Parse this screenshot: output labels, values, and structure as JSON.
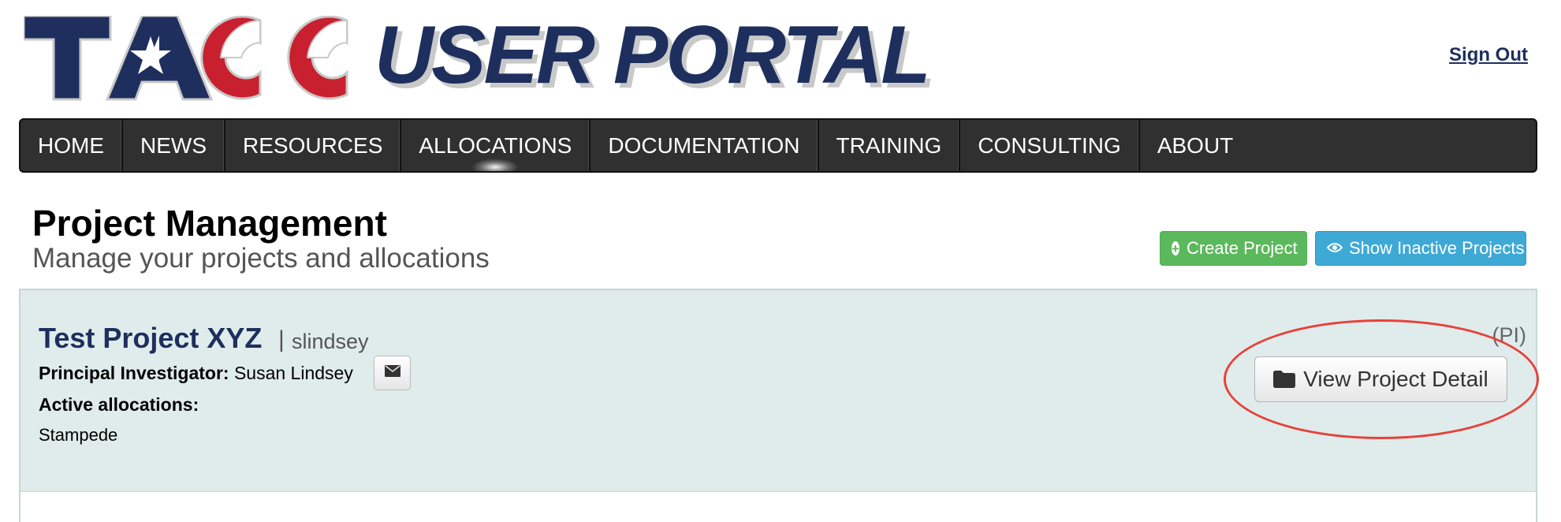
{
  "header": {
    "logo_text": "TACC",
    "portal_title": "USER PORTAL",
    "sign_out": "Sign Out"
  },
  "nav": {
    "items": [
      {
        "label": "HOME"
      },
      {
        "label": "NEWS"
      },
      {
        "label": "RESOURCES"
      },
      {
        "label": "ALLOCATIONS"
      },
      {
        "label": "DOCUMENTATION"
      },
      {
        "label": "TRAINING"
      },
      {
        "label": "CONSULTING"
      },
      {
        "label": "ABOUT"
      }
    ],
    "active": "ALLOCATIONS"
  },
  "page": {
    "title": "Project Management",
    "subtitle": "Manage your projects and allocations",
    "create_button": "Create Project",
    "inactive_button": "Show Inactive Projects"
  },
  "project": {
    "name": "Test Project XYZ",
    "separator": "|",
    "username": "slindsey",
    "role_tag": "(PI)",
    "pi_label": "Principal Investigator:",
    "pi_name": "Susan Lindsey",
    "allocations_label": "Active allocations:",
    "allocations": [
      "Stampede"
    ],
    "detail_button": "View Project Detail"
  },
  "colors": {
    "brand_navy": "#1e2f5e",
    "brand_red": "#c8202f",
    "nav_bg": "#303030",
    "panel_bg": "#dfeceb",
    "create_green": "#5cb85c",
    "inactive_blue": "#3fa9d6",
    "annotation_red": "#e8413b"
  },
  "icons": [
    "plus-circle-icon",
    "eye-icon",
    "envelope-icon",
    "folder-icon"
  ]
}
